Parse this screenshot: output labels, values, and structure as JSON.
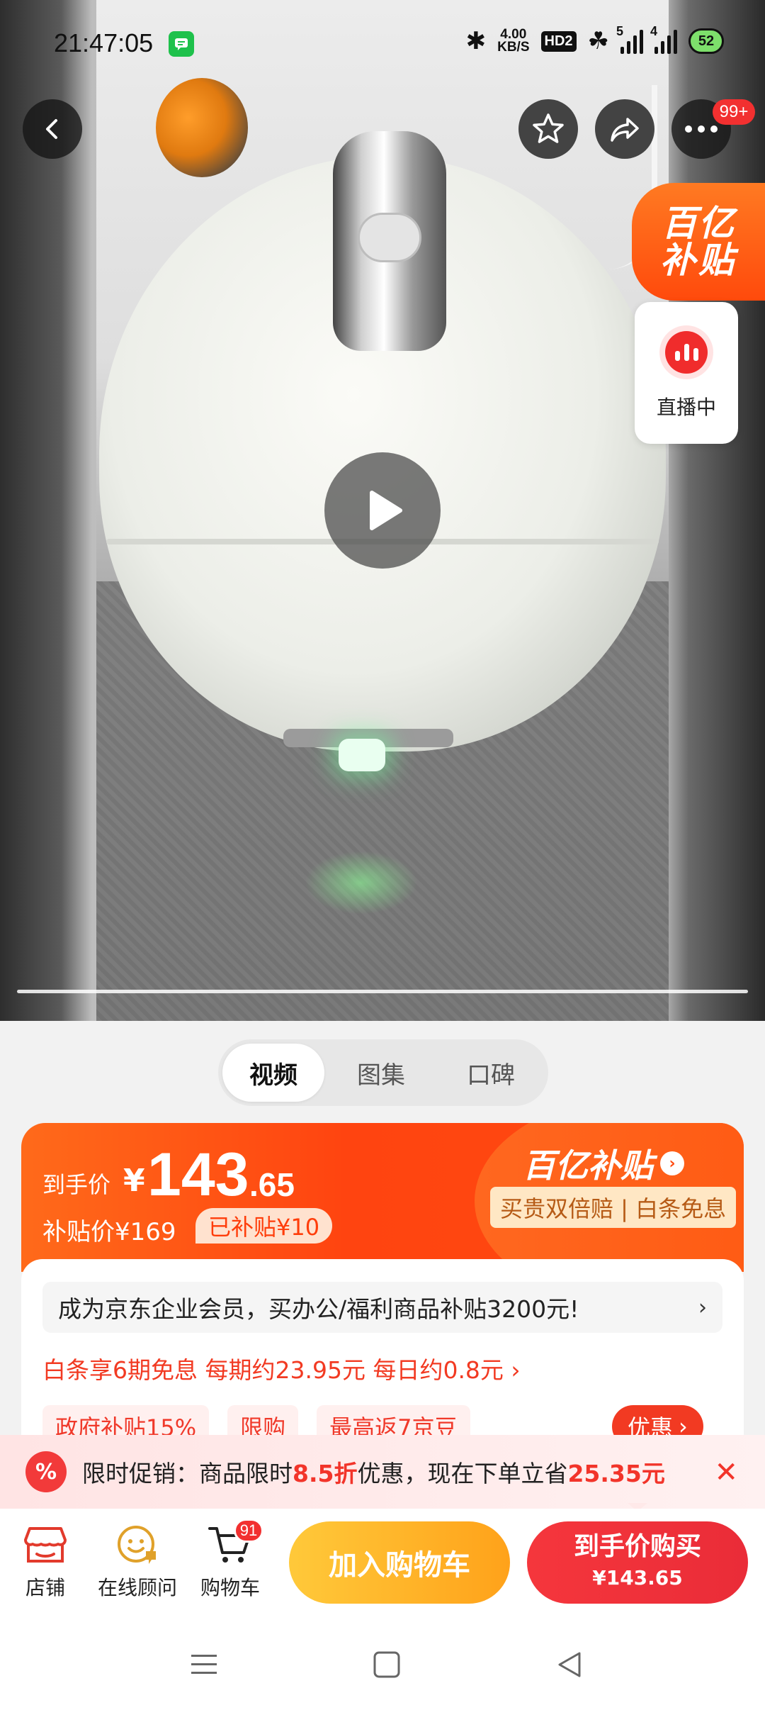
{
  "status_bar": {
    "time": "21:47:05",
    "net_speed_value": "4.00",
    "net_speed_unit": "KB/S",
    "hd_label": "HD2",
    "signal1_label": "5",
    "signal2_label": "4",
    "battery": "52"
  },
  "top_bar": {
    "cart_badge": "99+"
  },
  "side": {
    "yi_line1": "百亿",
    "yi_line2": "补贴",
    "live_label": "直播中"
  },
  "media_tabs": [
    "视频",
    "图集",
    "口碑"
  ],
  "price": {
    "final_label": "到手价",
    "currency": "¥",
    "final_int": "143",
    "final_dec": ".65",
    "subsidy_label": "补贴价¥169",
    "subsidy_pill": "已补贴¥10",
    "yi_logo": "百亿补贴",
    "yi_tag": "买贵双倍赔 | 白条免息"
  },
  "info": {
    "member_text": "成为京东企业会员，买办公/福利商品补贴3200元!",
    "baitiao": "白条享6期免息 每期约23.95元 每日约0.8元 ›",
    "chips": [
      "政府补贴15%",
      "限购",
      "最高返7京豆"
    ],
    "youhui": "优惠"
  },
  "promo": {
    "prefix": "限时促销：商品限时",
    "discount": "8.5折",
    "middle": "优惠，现在下单立省",
    "save": "25.35元"
  },
  "bottom": {
    "shop": "店铺",
    "advisor": "在线顾问",
    "cart": "购物车",
    "cart_count": "91",
    "add_cart": "加入购物车",
    "buy_line1": "到手价购买",
    "buy_line2": "¥143.65"
  },
  "colors": {
    "accent_red": "#f23a22",
    "orange": "#ff4a0f",
    "cart_yellow": "#ffb32a"
  }
}
